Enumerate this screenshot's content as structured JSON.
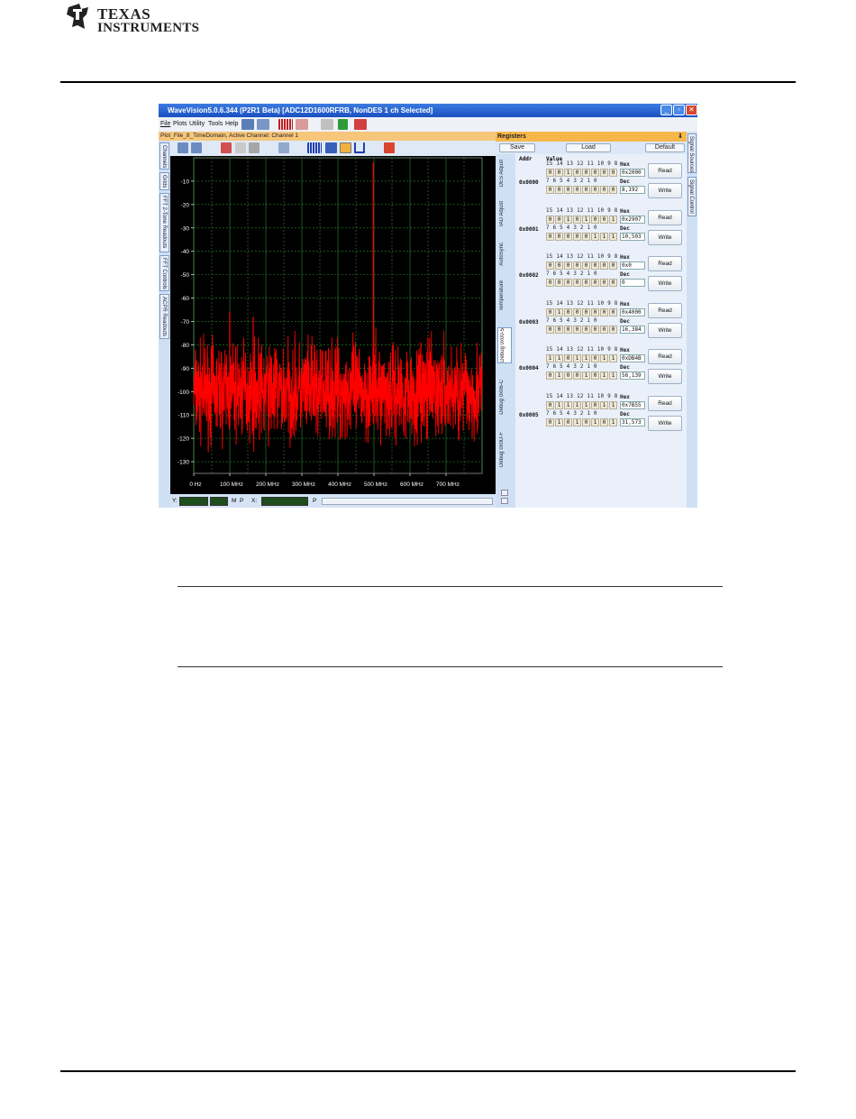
{
  "header": {
    "logo_line1": "Texas",
    "logo_line2": "Instruments"
  },
  "window": {
    "title": "WaveVision5.0.6.344 (P2R1 Beta) [ADC12D1600RFRB, NonDES 1 ch Selected]",
    "menu": [
      "File",
      "Plots",
      "Utility",
      "Tools",
      "Help"
    ],
    "doc_tab": "Plot_File_8_TimeDomain,  Active Channel: Channel 1",
    "left_tabs": [
      "Channels",
      "Grids",
      "FFT 2-Tone Readouts",
      "FFT Controls",
      "ACPR Readouts"
    ],
    "status": {
      "y_label": "Y:",
      "m_label": "M",
      "p_label": "P",
      "x_label": "X:",
      "p2_label": "P"
    }
  },
  "chart_data": {
    "type": "line",
    "series_color": "#ff0000",
    "background": "#000000",
    "grid": true,
    "grid_color": "#2e8b2e",
    "xlim": [
      0,
      800
    ],
    "ylim": [
      -135,
      0
    ],
    "x_tick_values": [
      0,
      100,
      200,
      300,
      400,
      500,
      600,
      700
    ],
    "x_tick_labels": [
      "0 Hz",
      "100 MHz",
      "200 MHz",
      "300 MHz",
      "400 MHz",
      "500 MHz",
      "600 MHz",
      "700 MHz"
    ],
    "y_tick_values": [
      -10,
      -20,
      -30,
      -40,
      -50,
      -60,
      -70,
      -80,
      -90,
      -100,
      -110,
      -120,
      -130
    ],
    "y_tick_labels": [
      "-10",
      "-20",
      "-30",
      "-40",
      "-50",
      "-60",
      "-70",
      "-80",
      "-90",
      "-100",
      "-110",
      "-120",
      "-130"
    ],
    "noise_floor_center": -100,
    "noise_floor_spread": 10,
    "spurs": [
      {
        "x": 498,
        "y": -2
      },
      {
        "x": 100,
        "y": -66
      },
      {
        "x": 165,
        "y": -68
      },
      {
        "x": 335,
        "y": -80
      },
      {
        "x": 488,
        "y": -85
      },
      {
        "x": 630,
        "y": -79
      }
    ]
  },
  "registers": {
    "title": "Registers",
    "pin_icon": "pin-icon",
    "actions": {
      "save": "Save",
      "load": "Load",
      "default": "Default"
    },
    "col_addr": "Addr",
    "col_value": "Value",
    "tabs": [
      "DES Adjust",
      "IAD Adjust",
      "AutoSync",
      "Temperature",
      "Debug 0x00-5",
      "Debug 0x06-C",
      "Debug 0x0D-F"
    ],
    "high_bit_labels": "15 14 13 12 11 10  9  8",
    "low_bit_labels": " 7  6  5  4  3  2  1  0",
    "hex_label": "Hex",
    "dec_label": "Dec",
    "read_label": "Read",
    "write_label": "Write",
    "rows": [
      {
        "addr": "0x0000",
        "high": [
          "0",
          "0",
          "1",
          "0",
          "0",
          "0",
          "0",
          "0"
        ],
        "low": [
          "0",
          "0",
          "0",
          "0",
          "0",
          "0",
          "0",
          "0"
        ],
        "hex": "0x2000",
        "dec": "8,192"
      },
      {
        "addr": "0x0001",
        "high": [
          "0",
          "0",
          "1",
          "0",
          "1",
          "0",
          "0",
          "1"
        ],
        "low": [
          "0",
          "0",
          "0",
          "0",
          "0",
          "1",
          "1",
          "1"
        ],
        "hex": "0x2907",
        "dec": "10,503"
      },
      {
        "addr": "0x0002",
        "high": [
          "0",
          "0",
          "0",
          "0",
          "0",
          "0",
          "0",
          "0"
        ],
        "low": [
          "0",
          "0",
          "0",
          "0",
          "0",
          "0",
          "0",
          "0"
        ],
        "hex": "0x0",
        "dec": "0"
      },
      {
        "addr": "0x0003",
        "high": [
          "0",
          "1",
          "0",
          "0",
          "0",
          "0",
          "0",
          "0"
        ],
        "low": [
          "0",
          "0",
          "0",
          "0",
          "0",
          "0",
          "0",
          "0"
        ],
        "hex": "0x4000",
        "dec": "16,384"
      },
      {
        "addr": "0x0004",
        "high": [
          "1",
          "1",
          "0",
          "1",
          "1",
          "0",
          "1",
          "1"
        ],
        "low": [
          "0",
          "1",
          "0",
          "0",
          "1",
          "0",
          "1",
          "1"
        ],
        "hex": "0xDB4B",
        "dec": "56,139"
      },
      {
        "addr": "0x0005",
        "high": [
          "0",
          "1",
          "1",
          "1",
          "1",
          "0",
          "1",
          "1"
        ],
        "low": [
          "0",
          "1",
          "0",
          "1",
          "0",
          "1",
          "0",
          "1"
        ],
        "hex": "0x7B55",
        "dec": "31,573"
      }
    ]
  },
  "right_tabs": [
    "Signal Sources",
    "Signal Control"
  ]
}
